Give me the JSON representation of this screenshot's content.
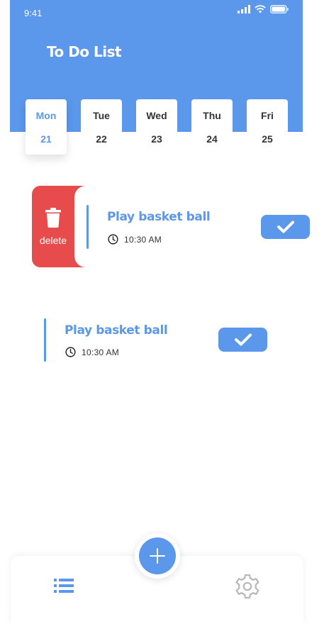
{
  "status_bar": {
    "time": "9:41"
  },
  "header": {
    "title": "To Do List"
  },
  "days": [
    {
      "name": "Mon",
      "date": "21",
      "active": true
    },
    {
      "name": "Tue",
      "date": "22",
      "active": false
    },
    {
      "name": "Wed",
      "date": "23",
      "active": false
    },
    {
      "name": "Thu",
      "date": "24",
      "active": false
    },
    {
      "name": "Fri",
      "date": "25",
      "active": false
    }
  ],
  "tasks": [
    {
      "title": "Play basket ball",
      "time": "10:30 AM",
      "swiped": true,
      "delete_label": "delete"
    },
    {
      "title": "Play basket ball",
      "time": "10:30 AM",
      "swiped": false
    }
  ],
  "icons": {
    "delete": "trash-icon",
    "time": "clock-icon",
    "complete": "check-icon",
    "add": "plus-icon",
    "list_nav": "list-icon",
    "settings_nav": "gear-icon"
  },
  "colors": {
    "accent": "#5b97ea",
    "danger": "#e84b4b",
    "inactive_icon": "#b7b7b7"
  }
}
